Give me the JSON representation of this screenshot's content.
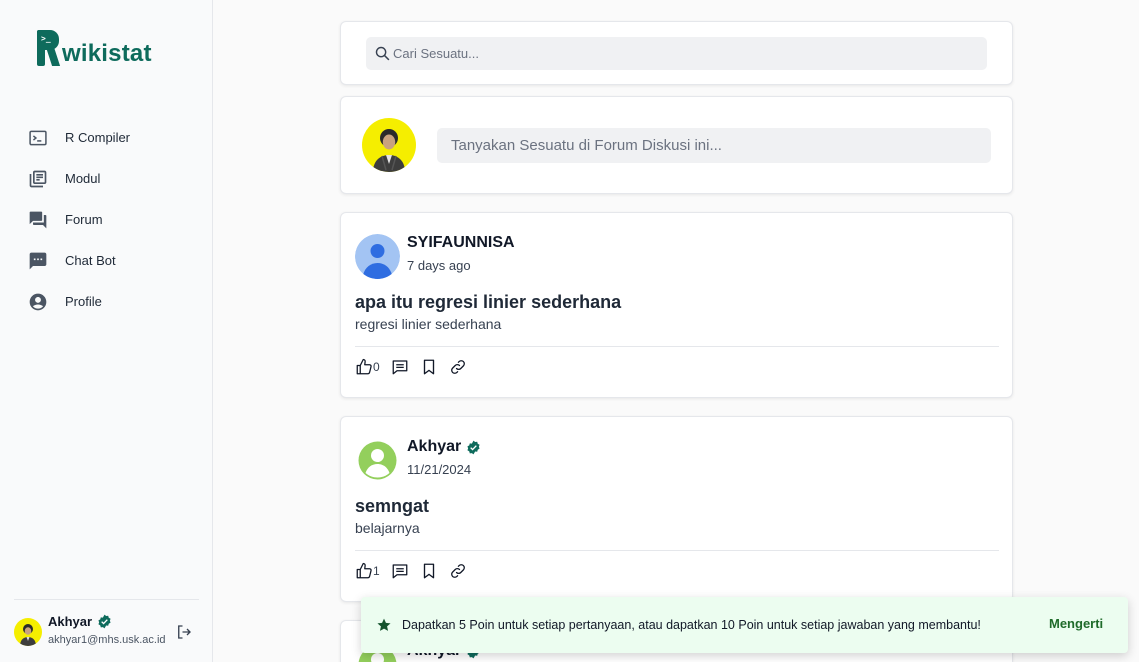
{
  "app": {
    "logo_text": "wikistat",
    "logo_terminal": ">_"
  },
  "sidebar": {
    "items": [
      {
        "label": "R Compiler",
        "icon": "terminal-icon"
      },
      {
        "label": "Modul",
        "icon": "library-icon"
      },
      {
        "label": "Forum",
        "icon": "forum-icon"
      },
      {
        "label": "Chat Bot",
        "icon": "chat-dots-icon"
      },
      {
        "label": "Profile",
        "icon": "account-circle-icon"
      }
    ],
    "user": {
      "name": "Akhyar",
      "email": "akhyar1@mhs.usk.ac.id",
      "verified": true
    }
  },
  "search": {
    "placeholder": "Cari Sesuatu..."
  },
  "ask": {
    "placeholder": "Tanyakan Sesuatu di Forum Diskusi ini..."
  },
  "posts": [
    {
      "author": "SYIFAUNNISA",
      "verified": false,
      "time": "7 days ago",
      "title": "apa itu regresi linier sederhana",
      "body": "regresi linier sederhana",
      "likes": "0"
    },
    {
      "author": "Akhyar",
      "verified": true,
      "time": "11/21/2024",
      "title": "semngat",
      "body": "belajarnya",
      "likes": "1"
    },
    {
      "author": "Akhyar",
      "verified": true
    }
  ],
  "toast": {
    "message": "Dapatkan 5 Poin untuk setiap pertanyaan, atau dapatkan 10 Poin untuk setiap jawaban yang membantu!",
    "action_label": "Mengerti"
  },
  "colors": {
    "brand": "#0e6b5c",
    "verified": "#0e6b5c",
    "toast_bg": "#ecfdf0",
    "toast_action": "#1f6b2a",
    "avatar_yellow": "#f5ee00"
  }
}
